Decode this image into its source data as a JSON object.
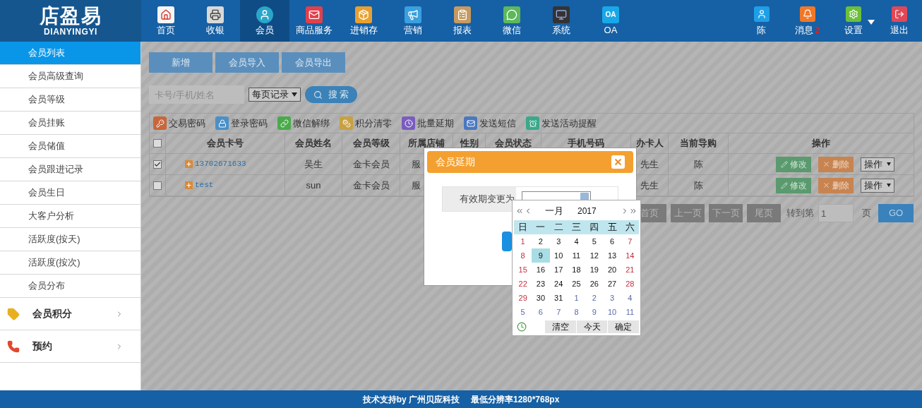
{
  "logo": {
    "name": "店盈易",
    "subtitle": "DIANYINGYI"
  },
  "nav": [
    {
      "label": "首页",
      "selected": false
    },
    {
      "label": "收银",
      "selected": false
    },
    {
      "label": "会员",
      "selected": true
    },
    {
      "label": "商品服务",
      "selected": false
    },
    {
      "label": "进销存",
      "selected": false
    },
    {
      "label": "营销",
      "selected": false
    },
    {
      "label": "报表",
      "selected": false
    },
    {
      "label": "微信",
      "selected": false
    },
    {
      "label": "系统",
      "selected": false
    },
    {
      "label": "OA",
      "icon_text": "OA",
      "selected": false
    }
  ],
  "user_menu": [
    {
      "label": "陈",
      "dropdown": false
    },
    {
      "label": "消息",
      "badge": "2",
      "dropdown": false
    },
    {
      "label": "设置",
      "dropdown": true
    },
    {
      "label": "退出",
      "dropdown": false
    }
  ],
  "sidebar": {
    "items": [
      {
        "label": "会员列表",
        "selected": true
      },
      {
        "label": "会员高级查询",
        "selected": false
      },
      {
        "label": "会员等级",
        "selected": false
      },
      {
        "label": "会员挂账",
        "selected": false
      },
      {
        "label": "会员储值",
        "selected": false
      },
      {
        "label": "会员跟进记录",
        "selected": false
      },
      {
        "label": "会员生日",
        "selected": false
      },
      {
        "label": "大客户分析",
        "selected": false
      },
      {
        "label": "活跃度(按天)",
        "selected": false
      },
      {
        "label": "活跃度(按次)",
        "selected": false
      },
      {
        "label": "会员分布",
        "selected": false
      }
    ],
    "groups": [
      {
        "label": "会员积分",
        "expanded": false
      },
      {
        "label": "预约",
        "expanded": false
      }
    ]
  },
  "toolbar": [
    "新增",
    "会员导入",
    "会员导出"
  ],
  "search": {
    "placeholder": "卡号/手机/姓名",
    "page_size": "每页记录",
    "button": "搜 索"
  },
  "actions": [
    "交易密码",
    "登录密码",
    "微信解绑",
    "积分清零",
    "批量延期",
    "发送短信",
    "发送活动提醒"
  ],
  "table": {
    "select_all_checked": false,
    "columns": [
      "会员卡号",
      "会员姓名",
      "会员等级",
      "所属店铺",
      "性别",
      "会员状态",
      "手机号码",
      "办卡人",
      "当前导购",
      "操作"
    ],
    "rows": [
      {
        "checked": true,
        "card_no": "13702671633",
        "name": "吴生",
        "level": "金卡会员",
        "store": "服",
        "card_issuer": "先生",
        "guide": "陈",
        "edit": "修改",
        "delete": "删除",
        "more": "操作"
      },
      {
        "checked": false,
        "card_no": "test",
        "name": "sun",
        "level": "金卡会员",
        "store": "服",
        "card_issuer": "先生",
        "guide": "陈",
        "edit": "修改",
        "delete": "删除",
        "more": "操作"
      }
    ]
  },
  "pagination": {
    "buttons": [
      "首页",
      "上一页",
      "下一页",
      "尾页"
    ],
    "goto_label": "转到第",
    "page": "1",
    "page_suffix": "页",
    "go": "GO"
  },
  "dialog": {
    "title": "会员延期",
    "field_label": "有效期变更为"
  },
  "calendar": {
    "month": "一月",
    "year": "2017",
    "weekdays": [
      "日",
      "一",
      "二",
      "三",
      "四",
      "五",
      "六"
    ],
    "days": [
      {
        "label": "1",
        "kind": "weekend",
        "selected": false
      },
      {
        "label": "2",
        "kind": "weekday",
        "selected": false
      },
      {
        "label": "3",
        "kind": "weekday",
        "selected": false
      },
      {
        "label": "4",
        "kind": "weekday",
        "selected": false
      },
      {
        "label": "5",
        "kind": "weekday",
        "selected": false
      },
      {
        "label": "6",
        "kind": "weekday",
        "selected": false
      },
      {
        "label": "7",
        "kind": "weekend",
        "selected": false
      },
      {
        "label": "8",
        "kind": "weekend",
        "selected": false
      },
      {
        "label": "9",
        "kind": "weekday",
        "selected": true
      },
      {
        "label": "10",
        "kind": "weekday",
        "selected": false
      },
      {
        "label": "11",
        "kind": "weekday",
        "selected": false
      },
      {
        "label": "12",
        "kind": "weekday",
        "selected": false
      },
      {
        "label": "13",
        "kind": "weekday",
        "selected": false
      },
      {
        "label": "14",
        "kind": "weekend",
        "selected": false
      },
      {
        "label": "15",
        "kind": "weekend",
        "selected": false
      },
      {
        "label": "16",
        "kind": "weekday",
        "selected": false
      },
      {
        "label": "17",
        "kind": "weekday",
        "selected": false
      },
      {
        "label": "18",
        "kind": "weekday",
        "selected": false
      },
      {
        "label": "19",
        "kind": "weekday",
        "selected": false
      },
      {
        "label": "20",
        "kind": "weekday",
        "selected": false
      },
      {
        "label": "21",
        "kind": "weekend",
        "selected": false
      },
      {
        "label": "22",
        "kind": "weekend",
        "selected": false
      },
      {
        "label": "23",
        "kind": "weekday",
        "selected": false
      },
      {
        "label": "24",
        "kind": "weekday",
        "selected": false
      },
      {
        "label": "25",
        "kind": "weekday",
        "selected": false
      },
      {
        "label": "26",
        "kind": "weekday",
        "selected": false
      },
      {
        "label": "27",
        "kind": "weekday",
        "selected": false
      },
      {
        "label": "28",
        "kind": "weekend",
        "selected": false
      },
      {
        "label": "29",
        "kind": "weekend",
        "selected": false
      },
      {
        "label": "30",
        "kind": "weekday",
        "selected": false
      },
      {
        "label": "31",
        "kind": "weekday",
        "selected": false
      },
      {
        "label": "1",
        "kind": "other",
        "selected": false
      },
      {
        "label": "2",
        "kind": "other",
        "selected": false
      },
      {
        "label": "3",
        "kind": "other",
        "selected": false
      },
      {
        "label": "4",
        "kind": "other",
        "selected": false
      },
      {
        "label": "5",
        "kind": "other",
        "selected": false
      },
      {
        "label": "6",
        "kind": "other",
        "selected": false
      },
      {
        "label": "7",
        "kind": "other",
        "selected": false
      },
      {
        "label": "8",
        "kind": "other",
        "selected": false
      },
      {
        "label": "9",
        "kind": "other",
        "selected": false
      },
      {
        "label": "10",
        "kind": "other",
        "selected": false
      },
      {
        "label": "11",
        "kind": "other",
        "selected": false
      }
    ],
    "buttons": [
      "清空",
      "今天",
      "确定"
    ]
  },
  "footer": {
    "support": "技术支持by 广州贝应科技",
    "resolution": "最低分辨率1280*768px"
  }
}
